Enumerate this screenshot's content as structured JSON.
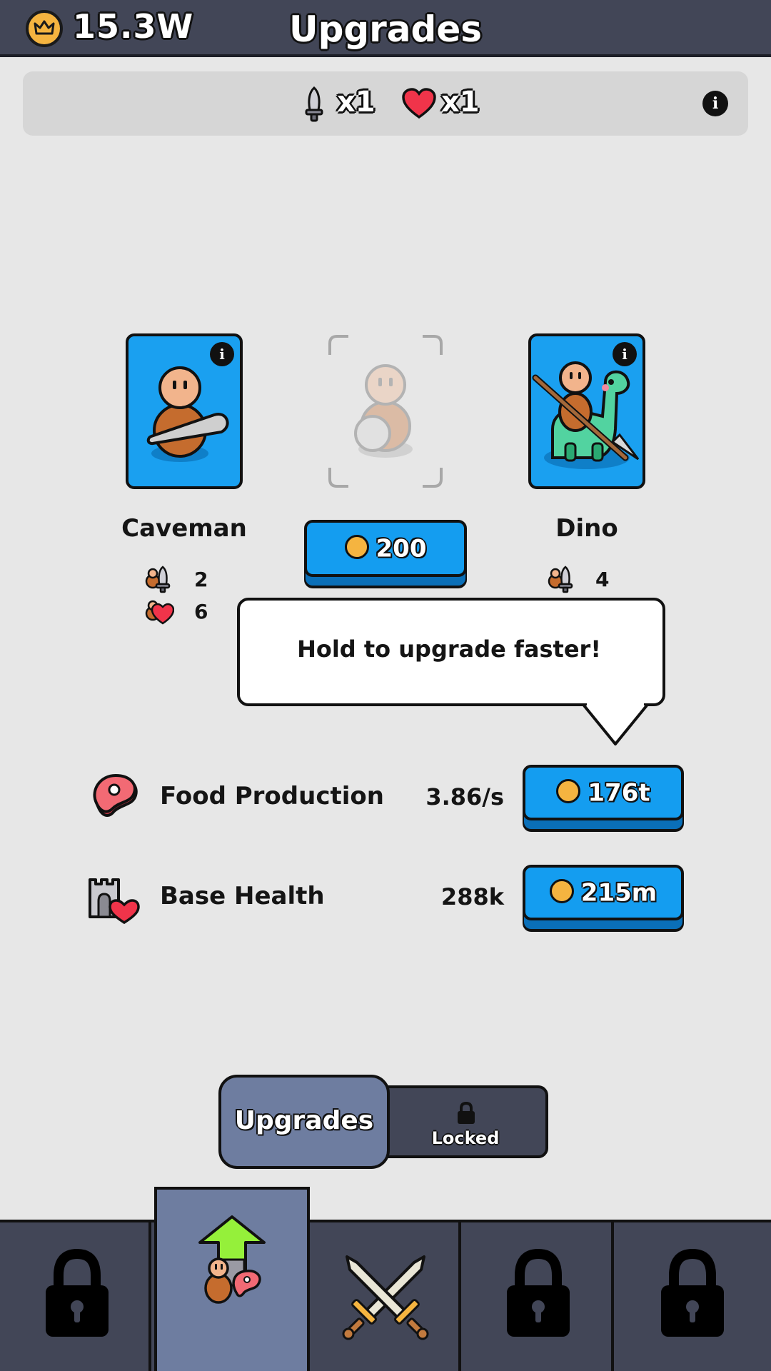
{
  "header": {
    "currency_value": "15.3W",
    "title": "Upgrades"
  },
  "multipliers": {
    "attack": "x1",
    "health": "x1"
  },
  "units": [
    {
      "name": "Caveman",
      "attack": "2",
      "health": "6"
    },
    {
      "name": "Dino",
      "attack": "4"
    }
  ],
  "slot_purchase": {
    "price": "200"
  },
  "tooltip": {
    "text": "Hold to upgrade faster!"
  },
  "upgrades": [
    {
      "label": "Food Production",
      "value": "3.86/s",
      "cost": "176t"
    },
    {
      "label": "Base Health",
      "value": "288k",
      "cost": "215m"
    }
  ],
  "tabs": {
    "active": "Upgrades",
    "locked": "Locked"
  },
  "colors": {
    "background": "#e7e7e7",
    "header": "#424657",
    "button_blue": "#149df0",
    "card_blue": "#1aa0f0",
    "active_tab": "#6e7da0",
    "coin": "#f5b440"
  },
  "icons": {
    "currency": "crown-coin-icon",
    "attack": "sword-icon",
    "health": "heart-icon",
    "food": "meat-icon",
    "base": "castle-heart-icon",
    "lock": "lock-icon",
    "battle": "crossed-swords-icon",
    "upgrade": "upgrade-arrow-icon"
  }
}
